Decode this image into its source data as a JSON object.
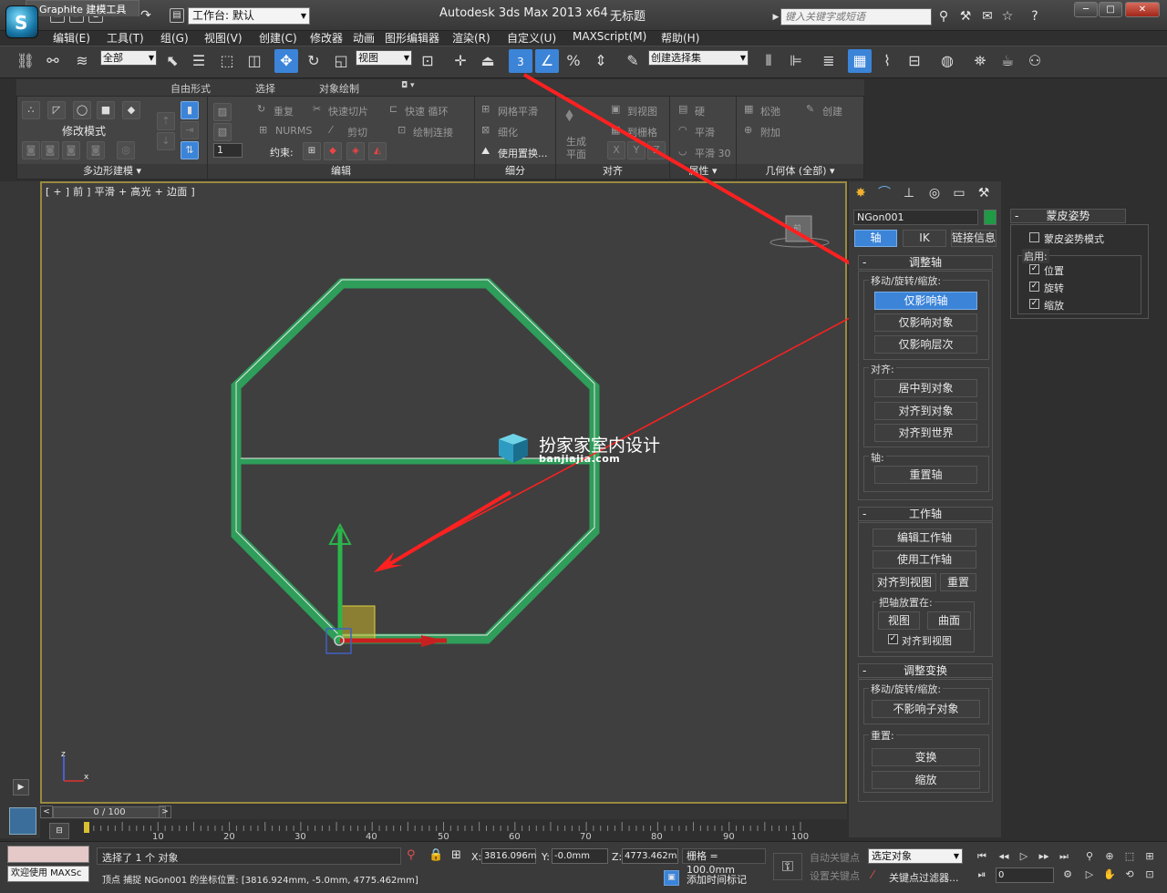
{
  "title_bar": {
    "workspace_label": "工作台: 默认",
    "app_title": "Autodesk 3ds Max  2013 x64",
    "doc_title": "无标题",
    "search_placeholder": "键入关键字或短语"
  },
  "menu": [
    "编辑(E)",
    "工具(T)",
    "组(G)",
    "视图(V)",
    "创建(C)",
    "修改器",
    "动画",
    "图形编辑器",
    "渲染(R)",
    "自定义(U)",
    "MAXScript(M)",
    "帮助(H)"
  ],
  "toolbar": {
    "selection_filter": "全部",
    "ref_coord": "视图",
    "snap_value": "3",
    "named_selection": "创建选择集"
  },
  "ribbon": {
    "tabs": [
      "Graphite 建模工具",
      "自由形式",
      "选择",
      "对象绘制"
    ],
    "modify_mode": "修改模式",
    "poly_modeling": "多边形建模 ▾",
    "spinner_value": "1",
    "edit_items": [
      "重复",
      "快速切片",
      "快速 循环",
      "NURMS",
      "剪切",
      "绘制连接"
    ],
    "constraint_label": "约束:",
    "subdiv_items": [
      "网格平滑",
      "细化",
      "使用置换..."
    ],
    "gen_plane_1": "生成",
    "gen_plane_2": "平面",
    "align_items": [
      "到视图",
      "到栅格"
    ],
    "props_items": [
      "硬",
      "平滑",
      "平滑 30"
    ],
    "geom_items": [
      "松弛",
      "创建",
      "附加"
    ],
    "panel_titles": [
      "编辑",
      "细分",
      "对齐",
      "属性 ▾",
      "几何体 (全部) ▾"
    ]
  },
  "viewport": {
    "label": "[ + ] 前 ] 平滑 + 高光 + 边面 ]",
    "watermark": "扮家家室内设计",
    "watermark_sub": "banjiajia.com",
    "axis_labels": [
      "z",
      "x",
      "y"
    ]
  },
  "command_panel": {
    "object_name": "NGon001",
    "object_color": "#1f9a45",
    "tabs": [
      "轴",
      "IK",
      "链接信息"
    ],
    "adjust_pivot": {
      "title": "调整轴",
      "move_label": "移动/旋转/缩放:",
      "move_buttons": [
        "仅影响轴",
        "仅影响对象",
        "仅影响层次"
      ],
      "align_label": "对齐:",
      "align_buttons": [
        "居中到对象",
        "对齐到对象",
        "对齐到世界"
      ],
      "pivot_label": "轴:",
      "reset_pivot": "重置轴"
    },
    "working_pivot": {
      "title": "工作轴",
      "edit": "编辑工作轴",
      "use": "使用工作轴",
      "align_view": "对齐到视图",
      "reset": "重置",
      "place_label": "把轴放置在:",
      "view_btn": "视图",
      "surface_btn": "曲面",
      "align_to_view_chk": "对齐到视图"
    },
    "adjust_transform": {
      "title": "调整变换",
      "move_label": "移动/旋转/缩放:",
      "no_affect": "不影响子对象",
      "reset_label": "重置:",
      "transform": "变换",
      "scale": "缩放"
    }
  },
  "skin_pose": {
    "title": "蒙皮姿势",
    "mode": "蒙皮姿势模式",
    "enable_label": "启用:",
    "items": [
      "位置",
      "旋转",
      "缩放"
    ]
  },
  "timeline": {
    "frame_display": "0 / 100",
    "ticks": [
      "10",
      "20",
      "30",
      "40",
      "50",
      "60",
      "70",
      "80",
      "90",
      "100"
    ]
  },
  "status_bar": {
    "welcome": "欢迎使用 MAXSc",
    "selected": "选择了 1 个 对象",
    "prompt": "顶点  捕捉 NGon001 的坐标位置:  [3816.924mm, -5.0mm, 4775.462mm]",
    "x_label": "X:",
    "x_value": "3816.096m",
    "y_label": "Y:",
    "y_value": "-0.0mm",
    "z_label": "Z:",
    "z_value": "4773.462m",
    "grid": "栅格 = 100.0mm",
    "auto_key": "自动关键点",
    "set_key": "设置关键点",
    "selected_obj": "选定对象",
    "key_filters": "关键点过滤器...",
    "add_time_tag": "添加时间标记",
    "frame": "0"
  }
}
